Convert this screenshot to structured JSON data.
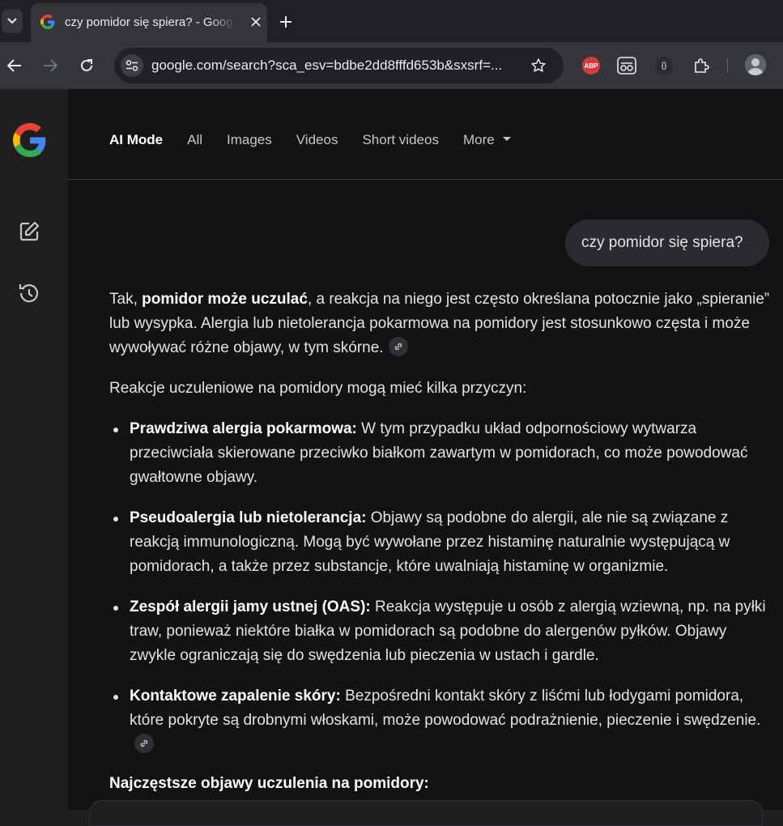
{
  "browser": {
    "tab_title": "czy pomidor się spiera? - Google",
    "url": "google.com/search?sca_esv=bdbe2dd8fffd653b&sxsrf=...",
    "extensions": [
      "ABP",
      "{}"
    ]
  },
  "nav": {
    "tabs": [
      "AI Mode",
      "All",
      "Images",
      "Videos",
      "Short videos",
      "More"
    ],
    "active_tab": "AI Mode"
  },
  "query": "czy pomidor się spiera?",
  "answer": {
    "intro": {
      "pre": "Tak, ",
      "bold": "pomidor może uczulać",
      "post": ", a reakcja na niego jest często określana potocznie jako „spieranie” lub wysypka. Alergia lub nietolerancja pokarmowa na pomidory jest stosunkowo częsta i może wywoływać różne objawy, w tym skórne."
    },
    "lead": "Reakcje uczuleniowe na pomidory mogą mieć kilka przyczyn:",
    "bullets": [
      {
        "title": "Prawdziwa alergia pokarmowa:",
        "text": " W tym przypadku układ odpornościowy wytwarza przeciwciała skierowane przeciwko białkom zawartym w pomidorach, co może powodować gwałtowne objawy."
      },
      {
        "title": "Pseudoalergia lub nietolerancja:",
        "text": " Objawy są podobne do alergii, ale nie są związane z reakcją immunologiczną. Mogą być wywołane przez histaminę naturalnie występującą w pomidorach, a także przez substancje, które uwalniają histaminę w organizmie."
      },
      {
        "title": "Zespół alergii jamy ustnej (OAS):",
        "text": " Reakcja występuje u osób z alergią wziewną, np. na pyłki traw, ponieważ niektóre białka w pomidorach są podobne do alergenów pyłków. Objawy zwykle ograniczają się do swędzenia lub pieczenia w ustach i gardle."
      },
      {
        "title": "Kontaktowe zapalenie skóry:",
        "text": " Bezpośredni kontakt skóry z liśćmi lub łodygami pomidora, które pokryte są drobnymi włoskami, może powodować podrażnienie, pieczenie i swędzenie."
      }
    ],
    "subheading": "Najczęstsze objawy uczulenia na pomidory:"
  },
  "colors": {
    "page_bg": "#131314",
    "sidebar_bg": "#1f1f1f",
    "text": "#e3e3e3",
    "chrome_tab": "#35363a",
    "chrome_strip": "#202124"
  }
}
